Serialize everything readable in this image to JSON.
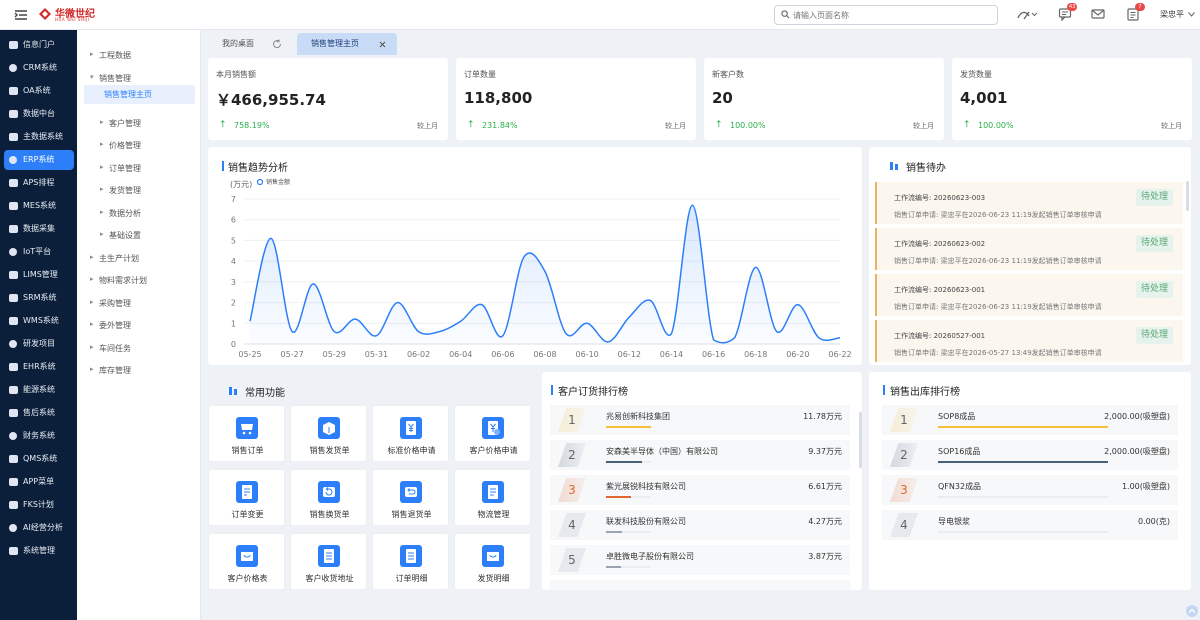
{
  "header": {
    "logo_name": "华微世纪",
    "logo_sub": "HUA WEI SHIJI",
    "search_placeholder": "请输入页面名称",
    "badges": {
      "messages": "43",
      "notices": "7"
    },
    "user_name": "梁忠平"
  },
  "sidebar": {
    "items": [
      {
        "label": "信息门户",
        "icon": "portal-icon"
      },
      {
        "label": "CRM系统",
        "icon": "crm-icon"
      },
      {
        "label": "OA系统",
        "icon": "oa-icon"
      },
      {
        "label": "数据中台",
        "icon": "data-center-icon"
      },
      {
        "label": "主数据系统",
        "icon": "master-data-icon"
      },
      {
        "label": "ERP系统",
        "icon": "erp-icon",
        "active": true
      },
      {
        "label": "APS排程",
        "icon": "aps-icon"
      },
      {
        "label": "MES系统",
        "icon": "mes-icon"
      },
      {
        "label": "数据采集",
        "icon": "collect-icon"
      },
      {
        "label": "IoT平台",
        "icon": "iot-icon"
      },
      {
        "label": "LIMS管理",
        "icon": "lims-icon"
      },
      {
        "label": "SRM系统",
        "icon": "srm-icon"
      },
      {
        "label": "WMS系统",
        "icon": "wms-icon"
      },
      {
        "label": "研发项目",
        "icon": "rd-icon"
      },
      {
        "label": "EHR系统",
        "icon": "ehr-icon"
      },
      {
        "label": "能源系统",
        "icon": "energy-icon"
      },
      {
        "label": "售后系统",
        "icon": "after-sales-icon"
      },
      {
        "label": "财务系统",
        "icon": "finance-icon"
      },
      {
        "label": "QMS系统",
        "icon": "qms-icon"
      },
      {
        "label": "APP菜单",
        "icon": "app-icon"
      },
      {
        "label": "FKS计划",
        "icon": "fks-icon"
      },
      {
        "label": "AI经营分析",
        "icon": "ai-icon"
      },
      {
        "label": "系统管理",
        "icon": "settings-icon"
      }
    ]
  },
  "subnav": {
    "items": [
      {
        "label": "工程数据",
        "level": 0,
        "caret": "▸"
      },
      {
        "label": "销售管理",
        "level": 0,
        "caret": "▾"
      },
      {
        "label": "销售管理主页",
        "level": 1,
        "caret": "",
        "active": true
      },
      {
        "label": "客户管理",
        "level": 1,
        "caret": "▸"
      },
      {
        "label": "价格管理",
        "level": 1,
        "caret": "▸"
      },
      {
        "label": "订单管理",
        "level": 1,
        "caret": "▸"
      },
      {
        "label": "发货管理",
        "level": 1,
        "caret": "▸"
      },
      {
        "label": "数据分析",
        "level": 1,
        "caret": "▸"
      },
      {
        "label": "基础设置",
        "level": 1,
        "caret": "▸"
      },
      {
        "label": "主生产计划",
        "level": 0,
        "caret": "▸"
      },
      {
        "label": "物料需求计划",
        "level": 0,
        "caret": "▸"
      },
      {
        "label": "采购管理",
        "level": 0,
        "caret": "▸"
      },
      {
        "label": "委外管理",
        "level": 0,
        "caret": "▸"
      },
      {
        "label": "车间任务",
        "level": 0,
        "caret": "▸"
      },
      {
        "label": "库存管理",
        "level": 0,
        "caret": "▸"
      }
    ]
  },
  "tabs": [
    {
      "label": "我的桌面"
    },
    {
      "label": "销售管理主页",
      "active": true
    }
  ],
  "kpis": [
    {
      "title": "本月销售额",
      "value": "￥466,955.74",
      "change": "758.19%",
      "compare": "较上月"
    },
    {
      "title": "订单数量",
      "value": "118,800",
      "change": "231.84%",
      "compare": "较上月"
    },
    {
      "title": "新客户数",
      "value": "20",
      "change": "100.00%",
      "compare": "较上月"
    },
    {
      "title": "发货数量",
      "value": "4,001",
      "change": "100.00%",
      "compare": "较上月"
    }
  ],
  "trend": {
    "title": "销售趋势分析"
  },
  "chart_data": {
    "type": "line",
    "title": "销售趋势分析",
    "ylabel": "(万元)",
    "legend": [
      "销售金额"
    ],
    "legend_position": "top-left",
    "ylim": [
      0,
      7
    ],
    "yticks": [
      "0",
      "1",
      "2",
      "3",
      "4",
      "5",
      "6",
      "7"
    ],
    "x": [
      "05-25",
      "05-26",
      "05-27",
      "05-28",
      "05-29",
      "05-30",
      "05-31",
      "06-01",
      "06-02",
      "06-03",
      "06-04",
      "06-05",
      "06-06",
      "06-07",
      "06-08",
      "06-09",
      "06-10",
      "06-11",
      "06-12",
      "06-13",
      "06-14",
      "06-15",
      "06-16",
      "06-17",
      "06-18",
      "06-19",
      "06-20",
      "06-21",
      "06-22"
    ],
    "xtick_labels": [
      "05-25",
      "05-27",
      "05-29",
      "05-31",
      "06-02",
      "06-04",
      "06-06",
      "06-08",
      "06-10",
      "06-12",
      "06-14",
      "06-16",
      "06-18",
      "06-20",
      "06-22"
    ],
    "series": [
      {
        "name": "销售金额",
        "color": "#2d7ff9",
        "values": [
          1.1,
          5.1,
          0.6,
          2.9,
          0.6,
          1.2,
          0.4,
          2.0,
          0.6,
          0.6,
          1.1,
          1.9,
          0.4,
          4.2,
          3.5,
          0.5,
          1.0,
          0.1,
          1.3,
          2.1,
          0.5,
          6.7,
          0.2,
          0.3,
          3.7,
          0.6,
          1.9,
          0.3,
          0.3
        ]
      }
    ]
  },
  "todo": {
    "title": "销售待办",
    "items": [
      {
        "code": "工作流编号: 20260623-003",
        "desc": "销售订单申请: 梁忠平在2026-06-23 11:19发起销售订单审核申请",
        "status": "待处理"
      },
      {
        "code": "工作流编号: 20260623-002",
        "desc": "销售订单申请: 梁忠平在2026-06-23 11:19发起销售订单审核申请",
        "status": "待处理"
      },
      {
        "code": "工作流编号: 20260623-001",
        "desc": "销售订单申请: 梁忠平在2026-06-23 11:19发起销售订单审核申请",
        "status": "待处理"
      },
      {
        "code": "工作流编号: 20260527-001",
        "desc": "销售订单申请: 梁忠平在2026-05-27 13:49发起销售订单审核申请",
        "status": "待处理"
      }
    ]
  },
  "functions": {
    "title": "常用功能",
    "items": [
      {
        "label": "销售订单",
        "icon": "cart-icon"
      },
      {
        "label": "销售发货单",
        "icon": "delivery-box-icon"
      },
      {
        "label": "标准价格申请",
        "icon": "price-yen-icon"
      },
      {
        "label": "客户价格申请",
        "icon": "price-yen-check-icon"
      },
      {
        "label": "订单变更",
        "icon": "document-edit-icon"
      },
      {
        "label": "销售换货单",
        "icon": "exchange-icon"
      },
      {
        "label": "销售退货单",
        "icon": "return-icon"
      },
      {
        "label": "物流管理",
        "icon": "logistics-doc-icon"
      },
      {
        "label": "客户价格表",
        "icon": "price-list-icon"
      },
      {
        "label": "客户收货地址",
        "icon": "address-doc-icon"
      },
      {
        "label": "订单明细",
        "icon": "order-detail-icon"
      },
      {
        "label": "发货明细",
        "icon": "shipment-detail-icon"
      }
    ]
  },
  "customer_rank": {
    "title": "客户订货排行榜",
    "items": [
      {
        "rank": "1",
        "name": "兆易创新科技集团",
        "value": "11.78万元",
        "fraction": 1.0
      },
      {
        "rank": "2",
        "name": "安森美半导体（中国）有限公司",
        "value": "9.37万元",
        "fraction": 0.8
      },
      {
        "rank": "3",
        "name": "紫光展锐科技有限公司",
        "value": "6.61万元",
        "fraction": 0.56
      },
      {
        "rank": "4",
        "name": "联发科技股份有限公司",
        "value": "4.27万元",
        "fraction": 0.36
      },
      {
        "rank": "5",
        "name": "卓胜微电子股份有限公司",
        "value": "3.87万元",
        "fraction": 0.33
      }
    ]
  },
  "outbound_rank": {
    "title": "销售出库排行榜",
    "items": [
      {
        "rank": "1",
        "name": "SOP8成品",
        "value": "2,000.00(吸塑盘)",
        "fraction": 1.0
      },
      {
        "rank": "2",
        "name": "SOP16成品",
        "value": "2,000.00(吸塑盘)",
        "fraction": 1.0
      },
      {
        "rank": "3",
        "name": "QFN32成品",
        "value": "1.00(吸塑盘)",
        "fraction": 0.0
      },
      {
        "rank": "4",
        "name": "导电银浆",
        "value": "0.00(克)",
        "fraction": 0.0
      }
    ]
  },
  "colors": {
    "accent": "#2d7ff9",
    "rank1": "#f3c03d",
    "rank2": "#4a5f7a",
    "rank3": "#e0662f",
    "rank_other": "#9aa3af",
    "increase": "#2bb14a"
  }
}
